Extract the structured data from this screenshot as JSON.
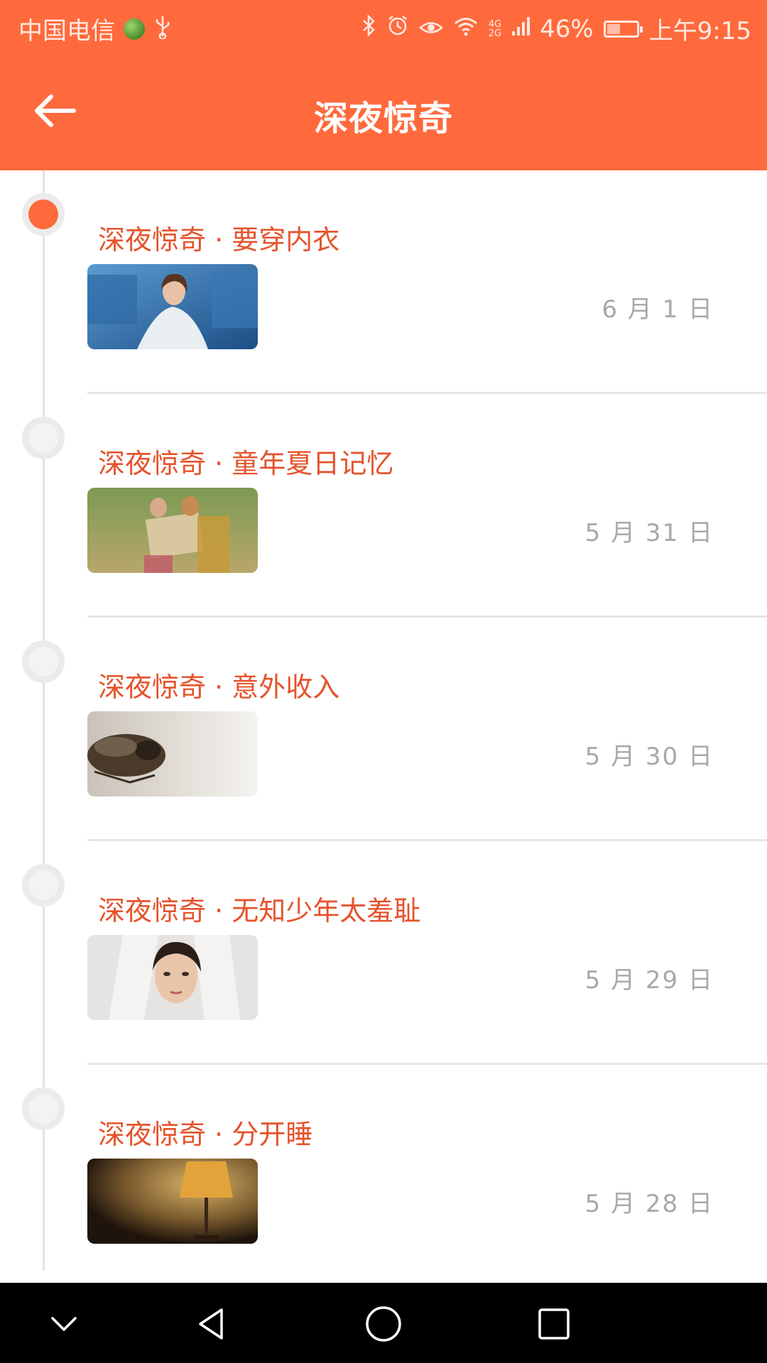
{
  "status_bar": {
    "carrier": "中国电信",
    "network_label_top": "4G",
    "network_label_bottom": "2G",
    "battery_percent": "46%",
    "battery_level": 0.46,
    "time": "上午9:15"
  },
  "app_bar": {
    "title": "深夜惊奇"
  },
  "items": [
    {
      "title": "深夜惊奇 · 要穿内衣",
      "date": "6 月 1 日",
      "active": true
    },
    {
      "title": "深夜惊奇 · 童年夏日记忆",
      "date": "5 月 31 日",
      "active": false
    },
    {
      "title": "深夜惊奇 · 意外收入",
      "date": "5 月 30 日",
      "active": false
    },
    {
      "title": "深夜惊奇 · 无知少年太羞耻",
      "date": "5 月 29 日",
      "active": false
    },
    {
      "title": "深夜惊奇 · 分开睡",
      "date": "5 月 28 日",
      "active": false
    }
  ],
  "colors": {
    "accent": "#ff6a3d",
    "title_text": "#e5532c",
    "date_text": "#a8a8a8"
  },
  "icons": {
    "back": "arrow-left-icon",
    "nav": [
      "chevron-down-icon",
      "back-triangle-icon",
      "home-circle-icon",
      "recents-square-icon"
    ]
  }
}
